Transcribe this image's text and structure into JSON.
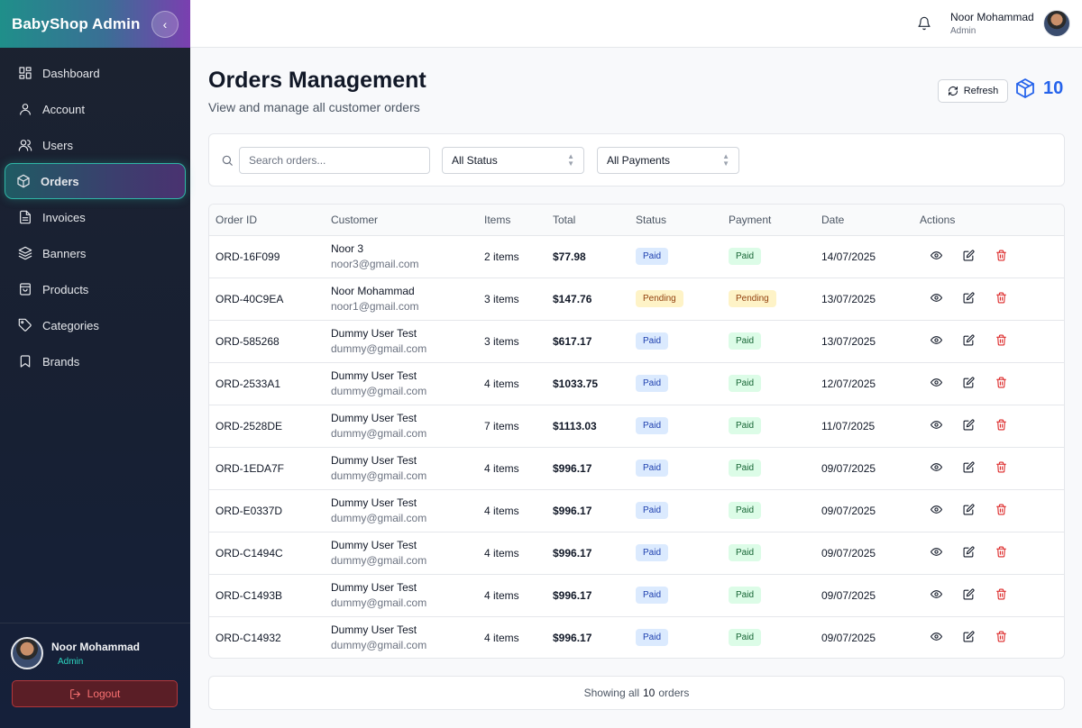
{
  "sidebar": {
    "brand": "BabyShop Admin",
    "items": [
      {
        "label": "Dashboard",
        "icon": "dashboard-icon"
      },
      {
        "label": "Account",
        "icon": "user-icon"
      },
      {
        "label": "Users",
        "icon": "users-icon"
      },
      {
        "label": "Orders",
        "icon": "package-icon"
      },
      {
        "label": "Invoices",
        "icon": "file-icon"
      },
      {
        "label": "Banners",
        "icon": "layers-icon"
      },
      {
        "label": "Products",
        "icon": "box-icon"
      },
      {
        "label": "Categories",
        "icon": "tag-icon"
      },
      {
        "label": "Brands",
        "icon": "bookmark-icon"
      }
    ],
    "active_index": 3,
    "user": {
      "name": "Noor Mohammad",
      "role": "Admin"
    },
    "logout_label": "Logout"
  },
  "topbar": {
    "user_name": "Noor Mohammad",
    "user_role": "Admin"
  },
  "page": {
    "title": "Orders Management",
    "subtitle": "View and manage all customer orders",
    "refresh_label": "Refresh",
    "order_count": "10"
  },
  "filters": {
    "search_placeholder": "Search orders...",
    "status_value": "All Status",
    "payment_value": "All Payments"
  },
  "table": {
    "columns": [
      "Order ID",
      "Customer",
      "Items",
      "Total",
      "Status",
      "Payment",
      "Date",
      "Actions"
    ],
    "rows": [
      {
        "id": "ORD-16F099",
        "name": "Noor 3",
        "email": "noor3@gmail.com",
        "items": "2 items",
        "total": "$77.98",
        "status": "Paid",
        "payment": "Paid",
        "date": "14/07/2025"
      },
      {
        "id": "ORD-40C9EA",
        "name": "Noor Mohammad",
        "email": "noor1@gmail.com",
        "items": "3 items",
        "total": "$147.76",
        "status": "Pending",
        "payment": "Pending",
        "date": "13/07/2025"
      },
      {
        "id": "ORD-585268",
        "name": "Dummy User Test",
        "email": "dummy@gmail.com",
        "items": "3 items",
        "total": "$617.17",
        "status": "Paid",
        "payment": "Paid",
        "date": "13/07/2025"
      },
      {
        "id": "ORD-2533A1",
        "name": "Dummy User Test",
        "email": "dummy@gmail.com",
        "items": "4 items",
        "total": "$1033.75",
        "status": "Paid",
        "payment": "Paid",
        "date": "12/07/2025"
      },
      {
        "id": "ORD-2528DE",
        "name": "Dummy User Test",
        "email": "dummy@gmail.com",
        "items": "7 items",
        "total": "$1113.03",
        "status": "Paid",
        "payment": "Paid",
        "date": "11/07/2025"
      },
      {
        "id": "ORD-1EDA7F",
        "name": "Dummy User Test",
        "email": "dummy@gmail.com",
        "items": "4 items",
        "total": "$996.17",
        "status": "Paid",
        "payment": "Paid",
        "date": "09/07/2025"
      },
      {
        "id": "ORD-E0337D",
        "name": "Dummy User Test",
        "email": "dummy@gmail.com",
        "items": "4 items",
        "total": "$996.17",
        "status": "Paid",
        "payment": "Paid",
        "date": "09/07/2025"
      },
      {
        "id": "ORD-C1494C",
        "name": "Dummy User Test",
        "email": "dummy@gmail.com",
        "items": "4 items",
        "total": "$996.17",
        "status": "Paid",
        "payment": "Paid",
        "date": "09/07/2025"
      },
      {
        "id": "ORD-C1493B",
        "name": "Dummy User Test",
        "email": "dummy@gmail.com",
        "items": "4 items",
        "total": "$996.17",
        "status": "Paid",
        "payment": "Paid",
        "date": "09/07/2025"
      },
      {
        "id": "ORD-C14932",
        "name": "Dummy User Test",
        "email": "dummy@gmail.com",
        "items": "4 items",
        "total": "$996.17",
        "status": "Paid",
        "payment": "Paid",
        "date": "09/07/2025"
      }
    ]
  },
  "footer": {
    "prefix": "Showing all",
    "count": "10",
    "suffix": "orders"
  },
  "colors": {
    "accent": "#2563eb",
    "teal": "#2dd4bf",
    "danger": "#dc2626"
  }
}
